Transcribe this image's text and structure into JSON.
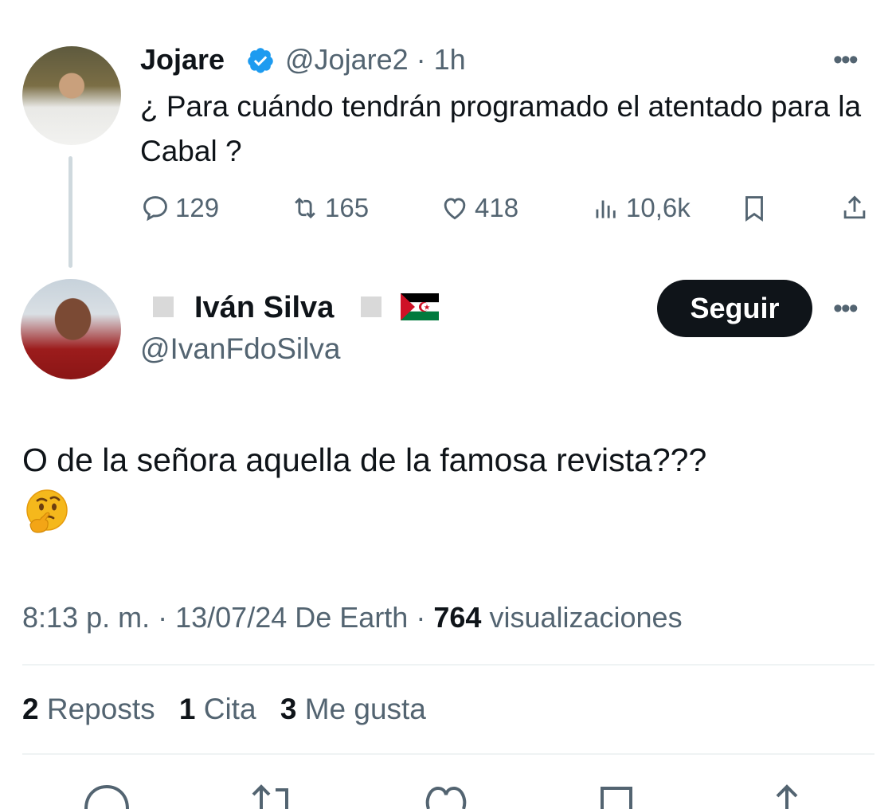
{
  "parent_tweet": {
    "author_name": "Jojare",
    "verified_icon": "verified-badge-icon",
    "handle": "@Jojare2",
    "separator": "·",
    "time": "1h",
    "text": "¿ Para cuándo tendrán programado el atentado para la Cabal ?",
    "replies": "129",
    "reposts": "165",
    "likes": "418",
    "views": "10,6k",
    "more_icon": "•••"
  },
  "reply_tweet": {
    "author_name": "Iván Silva",
    "handle": "@IvanFdoSilva",
    "follow_label": "Seguir",
    "more_icon": "•••",
    "text": "O de la señora aquella de la famosa revista???",
    "emoji": "thinking-face-emoji",
    "time": "8:13 p. m.",
    "date": "13/07/24",
    "source": "De Earth",
    "views_count": "764",
    "views_label": "visualizaciones",
    "reposts_count": "2",
    "reposts_label": "Reposts",
    "quotes_count": "1",
    "quotes_label": "Cita",
    "likes_count": "3",
    "likes_label": "Me gusta"
  },
  "colors": {
    "text": "#0f1419",
    "muted": "#536471",
    "verified": "#1d9bf0",
    "divider": "#eff3f4",
    "follow_bg": "#0f1419"
  }
}
